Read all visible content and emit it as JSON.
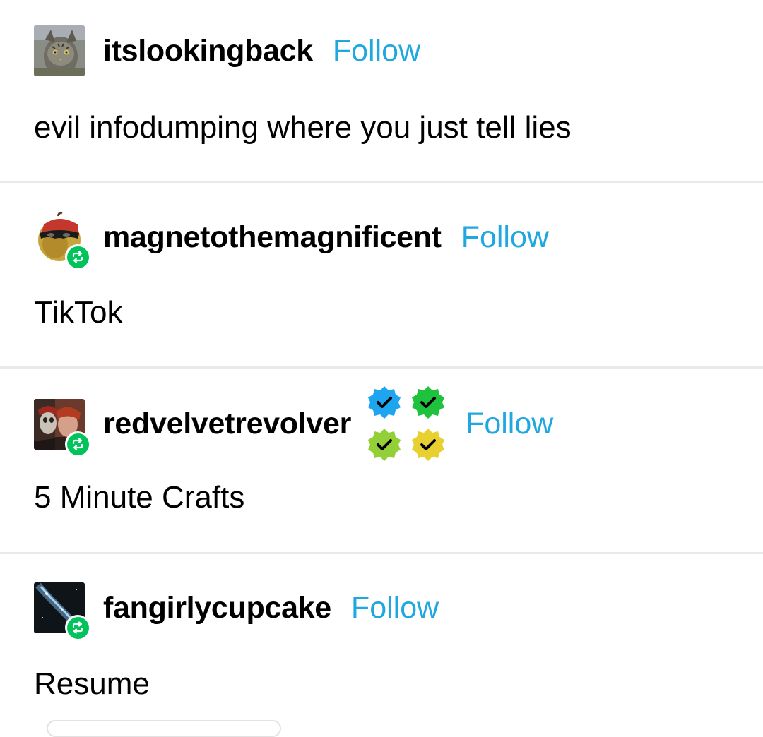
{
  "posts": [
    {
      "username": "itslookingback",
      "follow_label": "Follow",
      "text": "evil infodumping where you just tell lies",
      "avatar_icon": "cat-avatar-icon",
      "reblogged": false
    },
    {
      "username": "magnetothemagnificent",
      "follow_label": "Follow",
      "text": "TikTok",
      "avatar_icon": "masked-apple-avatar-icon",
      "reblogged": true
    },
    {
      "username": "redvelvetrevolver",
      "follow_label": "Follow",
      "text": "5 Minute Crafts",
      "avatar_icon": "portrait-avatar-icon",
      "reblogged": true,
      "verified_badges": [
        {
          "icon": "verified-check-badge-icon",
          "color": "#1ea5f0"
        },
        {
          "icon": "verified-check-badge-icon",
          "color": "#1ec23c"
        },
        {
          "icon": "verified-check-badge-icon",
          "color": "#93cf36"
        },
        {
          "icon": "verified-check-badge-icon",
          "color": "#e8d031"
        }
      ]
    },
    {
      "username": "fangirlycupcake",
      "follow_label": "Follow",
      "text": "Resume",
      "avatar_icon": "space-avatar-icon",
      "reblogged": true
    }
  ],
  "colors": {
    "follow": "#1fa8e0",
    "reblog_badge": "#00c35c",
    "divider": "#e9e9e9",
    "text": "#000000"
  }
}
